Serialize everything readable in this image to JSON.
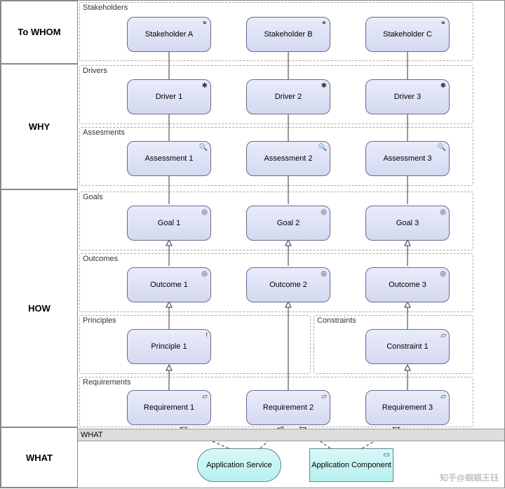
{
  "rows": {
    "r1": "To WHOM",
    "r2": "WHY",
    "r3": "HOW",
    "r4": "WHAT"
  },
  "groups": {
    "stakeholders": "Stakeholders",
    "drivers": "Drivers",
    "assessments": "Assesments",
    "goals": "Goals",
    "outcomes": "Outcomes",
    "principles": "Principles",
    "constraints": "Constraints",
    "requirements": "Requirements",
    "what": "WHAT"
  },
  "nodes": {
    "sa": "Stakeholder A",
    "sb": "Stakeholder B",
    "sc": "Stakeholder C",
    "d1": "Driver 1",
    "d2": "Driver 2",
    "d3": "Driver 3",
    "a1": "Assessment 1",
    "a2": "Assessment 2",
    "a3": "Assessment 3",
    "g1": "Goal 1",
    "g2": "Goal 2",
    "g3": "Goal 3",
    "o1": "Outcome 1",
    "o2": "Outcome 2",
    "o3": "Outcome 3",
    "p1": "Principle 1",
    "c1": "Constraint 1",
    "r1": "Requirement 1",
    "r2": "Requirement 2",
    "r3": "Requirement 3",
    "svc": "Application Service",
    "cmp": "Application Component"
  },
  "icons": {
    "stakeholder": "⚭",
    "driver": "✱",
    "assessment": "🔍",
    "goal": "◎",
    "outcome": "◎",
    "principle": "!",
    "constraint": "▱",
    "requirement": "▱",
    "component": "▭"
  },
  "watermark": "知乎@蝈蝈王钰"
}
